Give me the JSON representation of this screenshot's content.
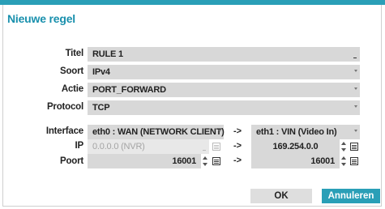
{
  "dialog": {
    "title": "Nieuwe regel",
    "labels": {
      "titel": "Titel",
      "soort": "Soort",
      "actie": "Actie",
      "protocol": "Protocol",
      "interface": "Interface",
      "ip": "IP",
      "poort": "Poort"
    },
    "fields": {
      "titel": "RULE 1",
      "soort": "IPv4",
      "actie": "PORT_FORWARD",
      "protocol": "TCP"
    },
    "source": {
      "interface": "eth0 : WAN (NETWORK CLIENT)",
      "ip": "0.0.0.0 (NVR)",
      "poort": "16001"
    },
    "destination": {
      "interface": "eth1 : VIN (Video In)",
      "ip": "169.254.0.0",
      "poort": "16001"
    },
    "arrow": "->",
    "buttons": {
      "ok": "OK",
      "cancel": "Annuleren"
    }
  },
  "colors": {
    "accent": "#2a9fb7",
    "title": "#1990ad",
    "field": "#d8d8d8"
  }
}
